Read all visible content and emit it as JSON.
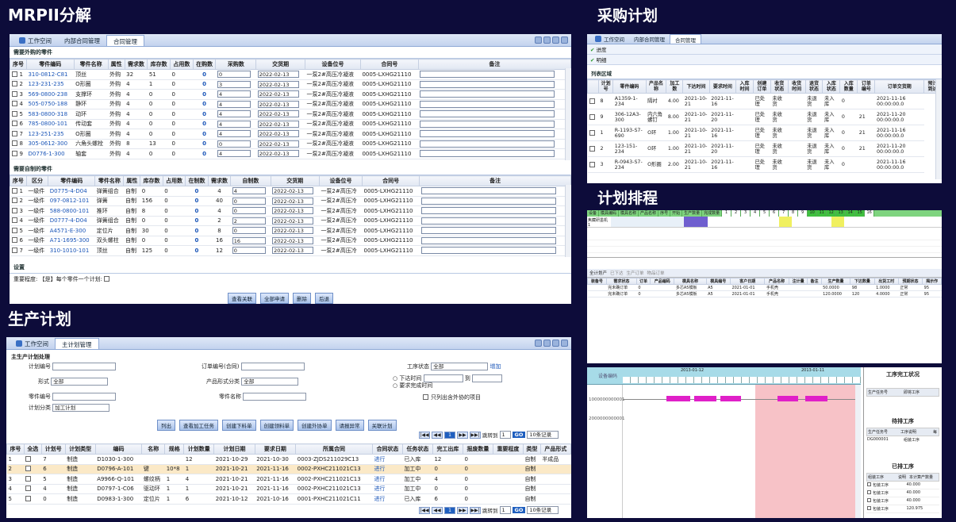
{
  "sections": {
    "mrp": "MRPII分解",
    "purchase": "采购计划",
    "production": "生产计划",
    "schedule": "计划排程"
  },
  "mrp": {
    "tabs": [
      "工作空间",
      "内部合同管理",
      "合同管理"
    ],
    "outsourced_title": "需要外购的零件",
    "outsourced_headers": [
      "序号",
      "零件编码",
      "零件名称",
      "属性",
      "需求数",
      "库存数",
      "占用数",
      "在购数",
      "采购数",
      "交货期",
      "设备位号",
      "合同号",
      "备注"
    ],
    "outsourced_rows": [
      [
        "1",
        "310-0812-C81",
        "顶丝",
        "外购",
        "32",
        "51",
        "0",
        "0",
        "0",
        "2022-02-13",
        "一泵2#高压冷凝液",
        "0005-LXHG21110"
      ],
      [
        "2",
        "123-231-235",
        "O形圈",
        "外购",
        "4",
        "1",
        "0",
        "0",
        "3",
        "2022-02-13",
        "一泵2#高压冷凝液",
        "0005-LXHG21110"
      ],
      [
        "3",
        "569-0800-238",
        "支撑环",
        "外购",
        "4",
        "0",
        "0",
        "0",
        "4",
        "2022-02-13",
        "一泵2#高压冷凝液",
        "0005-LXHG21110"
      ],
      [
        "4",
        "505-0750-188",
        "静环",
        "外购",
        "4",
        "0",
        "0",
        "0",
        "4",
        "2022-02-13",
        "一泵2#高压冷凝液",
        "0005-LXHG21110"
      ],
      [
        "5",
        "583-0800-318",
        "动环",
        "外购",
        "4",
        "0",
        "0",
        "0",
        "4",
        "2022-02-13",
        "一泵2#高压冷凝液",
        "0005-LXHG21110"
      ],
      [
        "6",
        "785-0800-101",
        "传动套",
        "外购",
        "4",
        "0",
        "0",
        "0",
        "4",
        "2022-02-13",
        "一泵2#高压冷凝液",
        "0005-LXHG21110"
      ],
      [
        "7",
        "123-251-235",
        "O形圈",
        "外购",
        "4",
        "0",
        "0",
        "0",
        "4",
        "2022-02-13",
        "一泵2#高压冷凝液",
        "0005-LXHG21110"
      ],
      [
        "8",
        "305-0612-300",
        "六角头螺栓",
        "外购",
        "8",
        "13",
        "0",
        "0",
        "0",
        "2022-02-13",
        "一泵2#高压冷凝液",
        "0005-LXHG21110"
      ],
      [
        "9",
        "D0776-1-300",
        "轴套",
        "外购",
        "4",
        "0",
        "0",
        "0",
        "4",
        "2022-02-13",
        "一泵2#高压冷凝液",
        "0005-LXHG21110"
      ]
    ],
    "selfmade_title": "需要自制的零件",
    "selfmade_headers": [
      "序号",
      "区分",
      "零件编码",
      "零件名称",
      "属性",
      "库存数",
      "占用数",
      "在制数",
      "需求数",
      "自制数",
      "交货期",
      "设备位号",
      "合同号",
      "备注"
    ],
    "selfmade_rows": [
      [
        "1",
        "一级件",
        "D0775-4-D04",
        "弹簧组合",
        "自制",
        "0",
        "0",
        "0",
        "4",
        "4",
        "2022-02-13",
        "一泵2#高压冷",
        "0005-LXHG21110"
      ],
      [
        "2",
        "一级件",
        "097-0812-101",
        "弹簧",
        "自制",
        "156",
        "0",
        "0",
        "40",
        "0",
        "2022-02-13",
        "一泵2#高压冷",
        "0005-LXHG21110"
      ],
      [
        "3",
        "一级件",
        "588-0800-101",
        "推环",
        "自制",
        "8",
        "0",
        "0",
        "4",
        "0",
        "2022-02-13",
        "一泵2#高压冷",
        "0005-LXHG21110"
      ],
      [
        "4",
        "一级件",
        "D0777-4-D04",
        "弹簧组合",
        "自制",
        "0",
        "0",
        "0",
        "2",
        "2",
        "2022-02-13",
        "一泵2#高压冷",
        "0005-LXHG21110"
      ],
      [
        "5",
        "一级件",
        "A4571-E-300",
        "定位片",
        "自制",
        "30",
        "0",
        "0",
        "8",
        "0",
        "2022-02-13",
        "一泵2#高压冷",
        "0005-LXHG21110"
      ],
      [
        "6",
        "一级件",
        "A71-1695-300",
        "双头螺柱",
        "自制",
        "0",
        "0",
        "0",
        "16",
        "16",
        "2022-02-13",
        "一泵2#高压冷",
        "0005-LXHG21110"
      ],
      [
        "7",
        "一级件",
        "310-1010-101",
        "顶丝",
        "自制",
        "125",
        "0",
        "0",
        "12",
        "0",
        "2022-02-13",
        "一泵2#高压冷",
        "0005-LXHG21110"
      ]
    ],
    "settings_title": "设置",
    "settings_text": "重要程度: 【是】每个零件一个计划:",
    "buttons": [
      "查看关联",
      "全部申请",
      "删除",
      "后退"
    ]
  },
  "purchase": {
    "tabs": [
      "工作空间",
      "内部合同管理",
      "合同管理"
    ],
    "menu": [
      "进度",
      "明细"
    ],
    "list_title": "列表区域",
    "headers": [
      "",
      "计划号",
      "零件编码",
      "产品名称",
      "加工数",
      "下达时间",
      "要求时间",
      "入库时间",
      "创建订单",
      "收货状态",
      "收货时间",
      "退货状态",
      "入库状态",
      "入库数量",
      "订单编号",
      "订单交货期",
      "预计到达"
    ],
    "rows": [
      [
        "8",
        "A1359-1-234",
        "隔衬",
        "4.00",
        "2021-10-21",
        "2021-11-16",
        "",
        "已处理",
        "未收货",
        "",
        "未退货",
        "未入库",
        "0",
        "",
        "2021-11-16 00:00:00.0"
      ],
      [
        "9",
        "306-12A3-300",
        "内六角螺钉",
        "8.00",
        "2021-10-21",
        "2021-11-20",
        "",
        "已处理",
        "未收货",
        "",
        "未退货",
        "未入库",
        "0",
        "21",
        "2021-11-20 00:00:00.0"
      ],
      [
        "1",
        "R-1193-S7-690",
        "O环",
        "1.00",
        "2021-10-21",
        "2021-11-16",
        "",
        "已处理",
        "未收货",
        "",
        "未退货",
        "未入库",
        "0",
        "21",
        "2021-11-16 00:00:00.0"
      ],
      [
        "2",
        "123-151-234",
        "O环",
        "1.00",
        "2021-10-21",
        "2021-11-20",
        "",
        "已处理",
        "未收货",
        "",
        "未退货",
        "未入库",
        "0",
        "21",
        "2021-11-20 00:00:00.0"
      ],
      [
        "3",
        "R-0943-S7-234",
        "O形圈",
        "2.00",
        "2021-10-21",
        "2021-11-16",
        "",
        "已处理",
        "未收货",
        "",
        "未退货",
        "未入库",
        "0",
        "",
        "2021-11-16 00:00:00.0"
      ]
    ]
  },
  "production": {
    "tabs": [
      "工作空间",
      "主计划管理"
    ],
    "form_title": "主生产计划处理",
    "labels": {
      "plan_no": "计划编号",
      "order_no": "订单编号(合同)",
      "status": "工序状态",
      "shape": "形式",
      "category": "产品形式分类",
      "part_no": "零件编号",
      "part_name": "零件名称",
      "plan_cat": "计划分类",
      "issue_time": "下达时间",
      "req_finish": "要求完成时间",
      "to": "到",
      "only_outsourced": "只列出含外协的项目",
      "add": "增加"
    },
    "values": {
      "status": "全部",
      "shape": "全部",
      "category": "全部",
      "plan_cat": "加工计划"
    },
    "buttons": [
      "列出",
      "查看加工任务",
      "创建下料单",
      "创建领料单",
      "创建外协单",
      "请报异常",
      "关联计划"
    ],
    "pager": {
      "current": "1",
      "jump": "跳转到",
      "page": "1",
      "go": "GO",
      "size": "10条记录"
    },
    "headers": [
      "序号",
      "全选",
      "计划号",
      "计划类型",
      "编码",
      "名称",
      "规格",
      "计划数量",
      "计划日期",
      "要求日期",
      "所属合同",
      "合同状态",
      "任务状态",
      "完工出库",
      "报废数量",
      "重要程度",
      "类型",
      "产品形式"
    ],
    "rows": [
      [
        "1",
        "7",
        "制造",
        "D1030-1-300",
        "",
        "",
        "12",
        "2021-10-29",
        "2021-10-30",
        "0003-ZJDS211029C13",
        "进行",
        "已入库",
        "12",
        "0",
        "",
        "自制",
        "半成品"
      ],
      [
        "2",
        "6",
        "制造",
        "D0796-A-101",
        "键",
        "10*8",
        "1",
        "2021-10-21",
        "2021-11-16",
        "0002-PXHC211021C13",
        "进行",
        "加工中",
        "0",
        "0",
        "",
        "自制",
        ""
      ],
      [
        "3",
        "5",
        "制造",
        "A9966-Q-101",
        "螺纹柄",
        "1",
        "4",
        "2021-10-21",
        "2021-11-16",
        "0002-PXHC211021C13",
        "进行",
        "加工中",
        "4",
        "0",
        "",
        "自制",
        ""
      ],
      [
        "4",
        "4",
        "制造",
        "D0797-1-C06",
        "驱动环",
        "1",
        "1",
        "2021-10-21",
        "2021-11-16",
        "0002-PXHC211021C13",
        "进行",
        "加工中",
        "0",
        "0",
        "",
        "自制",
        ""
      ],
      [
        "5",
        "0",
        "制造",
        "D0983-1-300",
        "定位片",
        "1",
        "6",
        "2021-10-12",
        "2021-10-16",
        "0001-PXHC211021C11",
        "进行",
        "已入库",
        "6",
        "0",
        "",
        "自制",
        ""
      ]
    ]
  },
  "schedule": {
    "top_headers": [
      "设备",
      "模具编码",
      "模具名称",
      "产品名称",
      "序号",
      "开始",
      "生产数量",
      "完成数量"
    ],
    "days": [
      "1",
      "2",
      "3",
      "4",
      "5",
      "6",
      "7",
      "8",
      "9",
      "10",
      "11",
      "12",
      "13",
      "14",
      "15",
      "16"
    ],
    "top_rows": [
      [
        "焦藏研墨机1",
        "",
        "",
        "",
        "",
        "",
        "",
        ""
      ]
    ],
    "tabs2": [
      "全计划产",
      "已下达",
      "生产订单",
      "物品订单"
    ],
    "table2_headers": [
      "装备号",
      "需求状态",
      "订单",
      "产品编码",
      "模具名称",
      "模具编号",
      "客户日期",
      "产品名称",
      "注计量",
      "备注",
      "生产数量",
      "下达数量",
      "出货工时",
      "预期状态",
      "揭示作"
    ],
    "table2_rows": [
      [
        "",
        "完未确订单",
        "0",
        "",
        "多芯A5模板",
        "A5",
        "2021-01-01",
        "手机壳",
        "",
        "",
        "50.0000",
        "98",
        "1.0000",
        "正常",
        "95"
      ],
      [
        "",
        "完未确订单",
        "0",
        "",
        "多芯A5模板",
        "A5",
        "2021-01-01",
        "手机壳",
        "",
        "",
        "120.0000",
        "120",
        "4.0000",
        "正常",
        "95"
      ]
    ],
    "gantt_label": "设备编码",
    "gantt_dates": [
      "2013-01-12",
      "2013-01-11"
    ],
    "gantt_rows": [
      "1000000000001",
      "2000000000001"
    ],
    "right_title": "工序完工状况",
    "right_headers": [
      "生产任务号",
      "即将工序"
    ],
    "pending_title": "待排工序",
    "pending_headers": [
      "生产任务号",
      "工序说明",
      "每"
    ],
    "pending_rows": [
      [
        "DG000001",
        "组装工序"
      ]
    ],
    "done_title": "已排工序",
    "done_headers": [
      "组装工序",
      "说明",
      "本计算产数量"
    ],
    "done_rows": [
      [
        "包装工序",
        "40.000"
      ],
      [
        "包装工序",
        "40.000"
      ],
      [
        "包装工序",
        "40.000"
      ],
      [
        "包装工序",
        "120.975"
      ]
    ]
  }
}
